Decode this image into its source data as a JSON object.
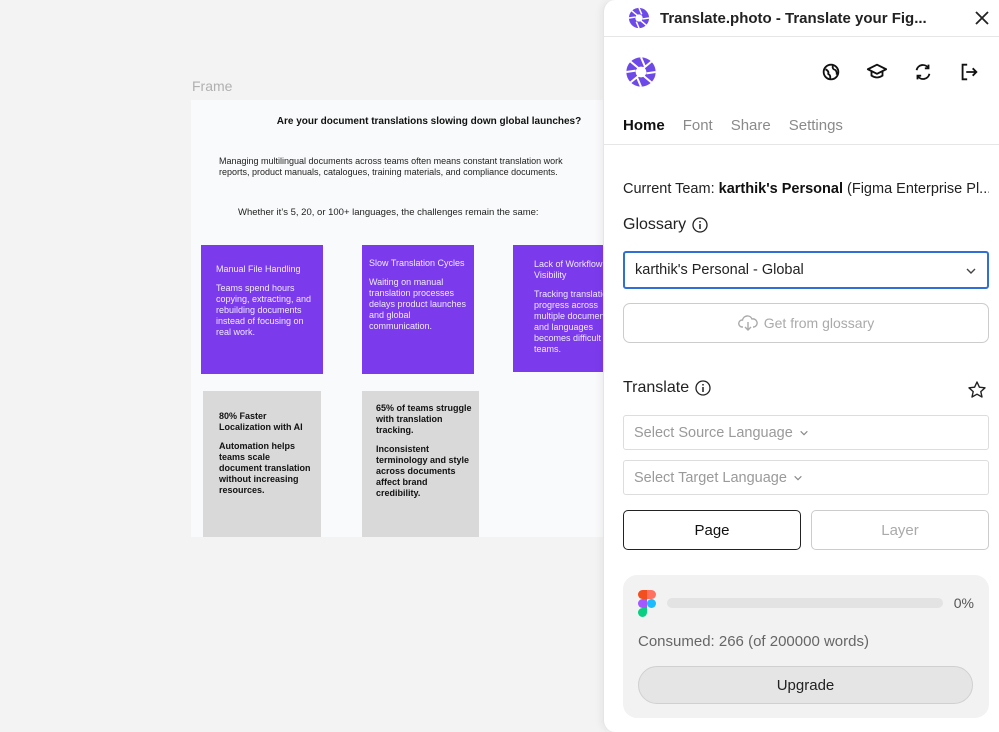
{
  "canvas": {
    "frame_label": "Frame",
    "heading": "Are your document translations slowing down global launches?",
    "intro_line1": "Managing multilingual documents across teams often means constant translation work",
    "intro_line2": "reports, product manuals, catalogues, training materials, and compliance documents.",
    "subheading": "Whether it’s 5, 20, or 100+ languages, the challenges remain the same:",
    "cards": [
      {
        "title": "Manual File Handling",
        "body": "Teams spend hours copying, extracting, and rebuilding documents instead of focusing on real work."
      },
      {
        "title": "Slow Translation Cycles",
        "body": "Waiting on manual translation processes delays product launches and global communication."
      },
      {
        "title": "Lack of Workflow Visibility",
        "body": "Tracking translation progress across multiple documents and languages becomes difficult for teams."
      },
      {
        "title": "80% Faster Localization with AI",
        "body": "Automation helps teams scale document translation without increasing resources."
      },
      {
        "title": "65% of teams struggle with translation tracking.",
        "body": "Inconsistent terminology and style across documents affect brand credibility."
      }
    ]
  },
  "panel": {
    "title": "Translate.photo - Translate your Fig...",
    "tabs": [
      "Home",
      "Font",
      "Share",
      "Settings"
    ],
    "active_tab": "Home",
    "team_label": "Current Team:",
    "team_name": "karthik's Personal",
    "team_plan": "(Figma Enterprise Pl...",
    "glossary_title": "Glossary",
    "glossary_value": "karthik's Personal - Global",
    "get_glossary": "Get from glossary",
    "translate_title": "Translate",
    "source_placeholder": "Select Source Language",
    "target_placeholder": "Select Target Language",
    "page_btn": "Page",
    "layer_btn": "Layer",
    "progress_pct": "0%",
    "progress_value": 0,
    "consumed": "Consumed: 266 (of 200000 words)",
    "upgrade": "Upgrade",
    "accent": "#7c3aed"
  }
}
